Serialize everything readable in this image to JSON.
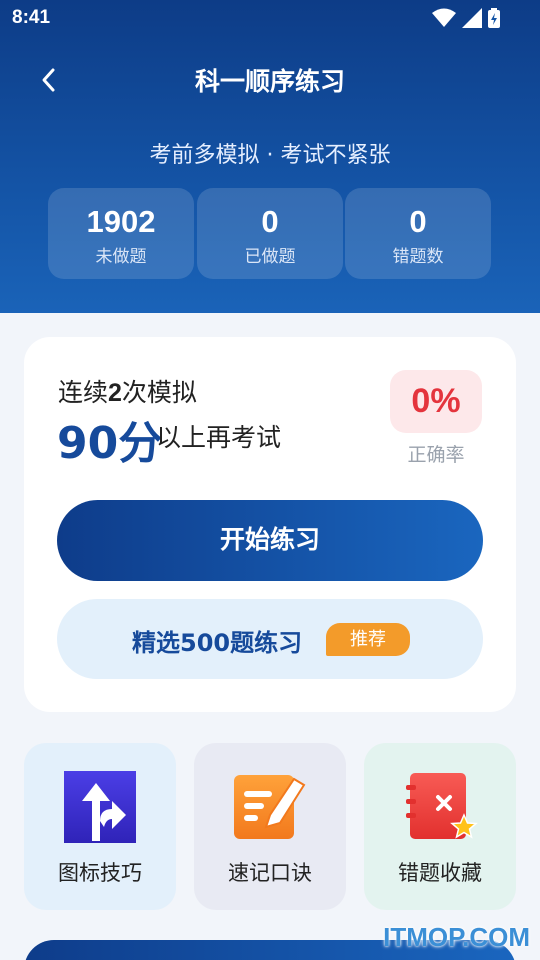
{
  "status_bar": {
    "time": "8:41"
  },
  "header": {
    "title": "科一顺序练习",
    "subtitle": "考前多模拟 · 考试不紧张"
  },
  "stats": [
    {
      "value": "1902",
      "label": "未做题"
    },
    {
      "value": "0",
      "label": "已做题"
    },
    {
      "value": "0",
      "label": "错题数"
    }
  ],
  "card": {
    "line1_a": "连续",
    "line1_num": "2",
    "line1_b": "次模拟",
    "score": "90分",
    "score_rest": "以上再考试",
    "accuracy_value": "0%",
    "accuracy_label": "正确率",
    "start_button": "开始练习",
    "select_button": "精选500题练习",
    "recommend_tag": "推荐"
  },
  "tiles": [
    {
      "label": "图标技巧",
      "icon": "traffic-sign-icon",
      "bg": "#e3f0fb"
    },
    {
      "label": "速记口诀",
      "icon": "note-pencil-icon",
      "bg": "#e8eaf3"
    },
    {
      "label": "错题收藏",
      "icon": "wrong-book-icon",
      "bg": "#e3f3ef"
    }
  ],
  "watermark": "ITMOP.COM",
  "colors": {
    "primary": "#164a9b",
    "accent": "#f39b2a",
    "error": "#e4343d"
  }
}
